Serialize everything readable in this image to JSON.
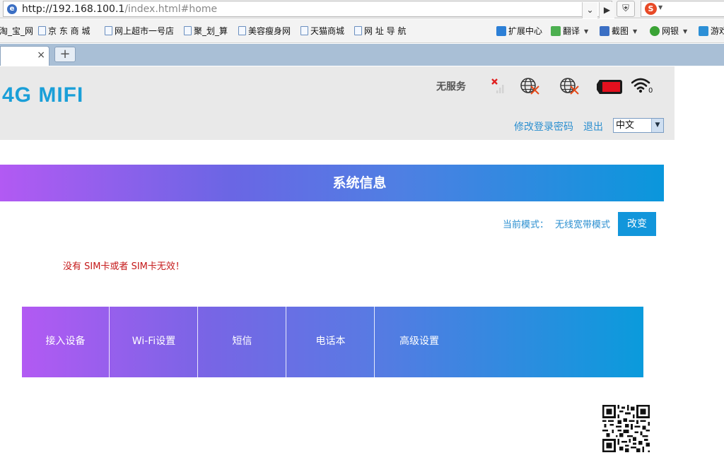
{
  "browser": {
    "url_host": "http://192.168.100.1",
    "url_path": "/index.html#home",
    "bookmarks": [
      {
        "label": "淘_宝_网"
      },
      {
        "label": "京 东 商 城"
      },
      {
        "label": "网上超市一号店"
      },
      {
        "label": "聚_划_算"
      },
      {
        "label": "美容瘦身网"
      },
      {
        "label": "天猫商城"
      },
      {
        "label": "网 址 导 航"
      }
    ],
    "tools": [
      {
        "label": "扩展中心",
        "icon": "cube-icon",
        "color": "#2c7fd6"
      },
      {
        "label": "翻译",
        "icon": "translate-icon",
        "color": "#4caf50"
      },
      {
        "label": "截图",
        "icon": "screenshot-icon",
        "color": "#3b6fc4"
      },
      {
        "label": "网银",
        "icon": "bank-icon",
        "color": "#3aa335"
      },
      {
        "label": "游戏",
        "icon": "game-icon",
        "color": "#2c8fd6"
      }
    ],
    "tab_close": "×",
    "new_tab": "+"
  },
  "header": {
    "logo": "4G MIFI",
    "service_status": "无服务",
    "wifi_clients": "0",
    "change_password": "修改登录密码",
    "logout": "退出",
    "language": "中文"
  },
  "main": {
    "title": "系统信息",
    "mode_label": "当前模式：",
    "mode_value": "无线宽带模式",
    "change_button": "改变",
    "sim_message": "没有 SIM卡或者 SIM卡无效！",
    "nav_items": [
      {
        "label": "接入设备"
      },
      {
        "label": "Wi-Fi设置"
      },
      {
        "label": "短信"
      },
      {
        "label": "电话本"
      },
      {
        "label": "高级设置"
      }
    ]
  },
  "colors": {
    "accent_blue": "#1296db",
    "logo_blue": "#1a9fd8",
    "link_blue": "#2b8fd0",
    "error_red": "#c5191a",
    "gradient_start": "#b25af3",
    "gradient_end": "#0a97dc"
  }
}
